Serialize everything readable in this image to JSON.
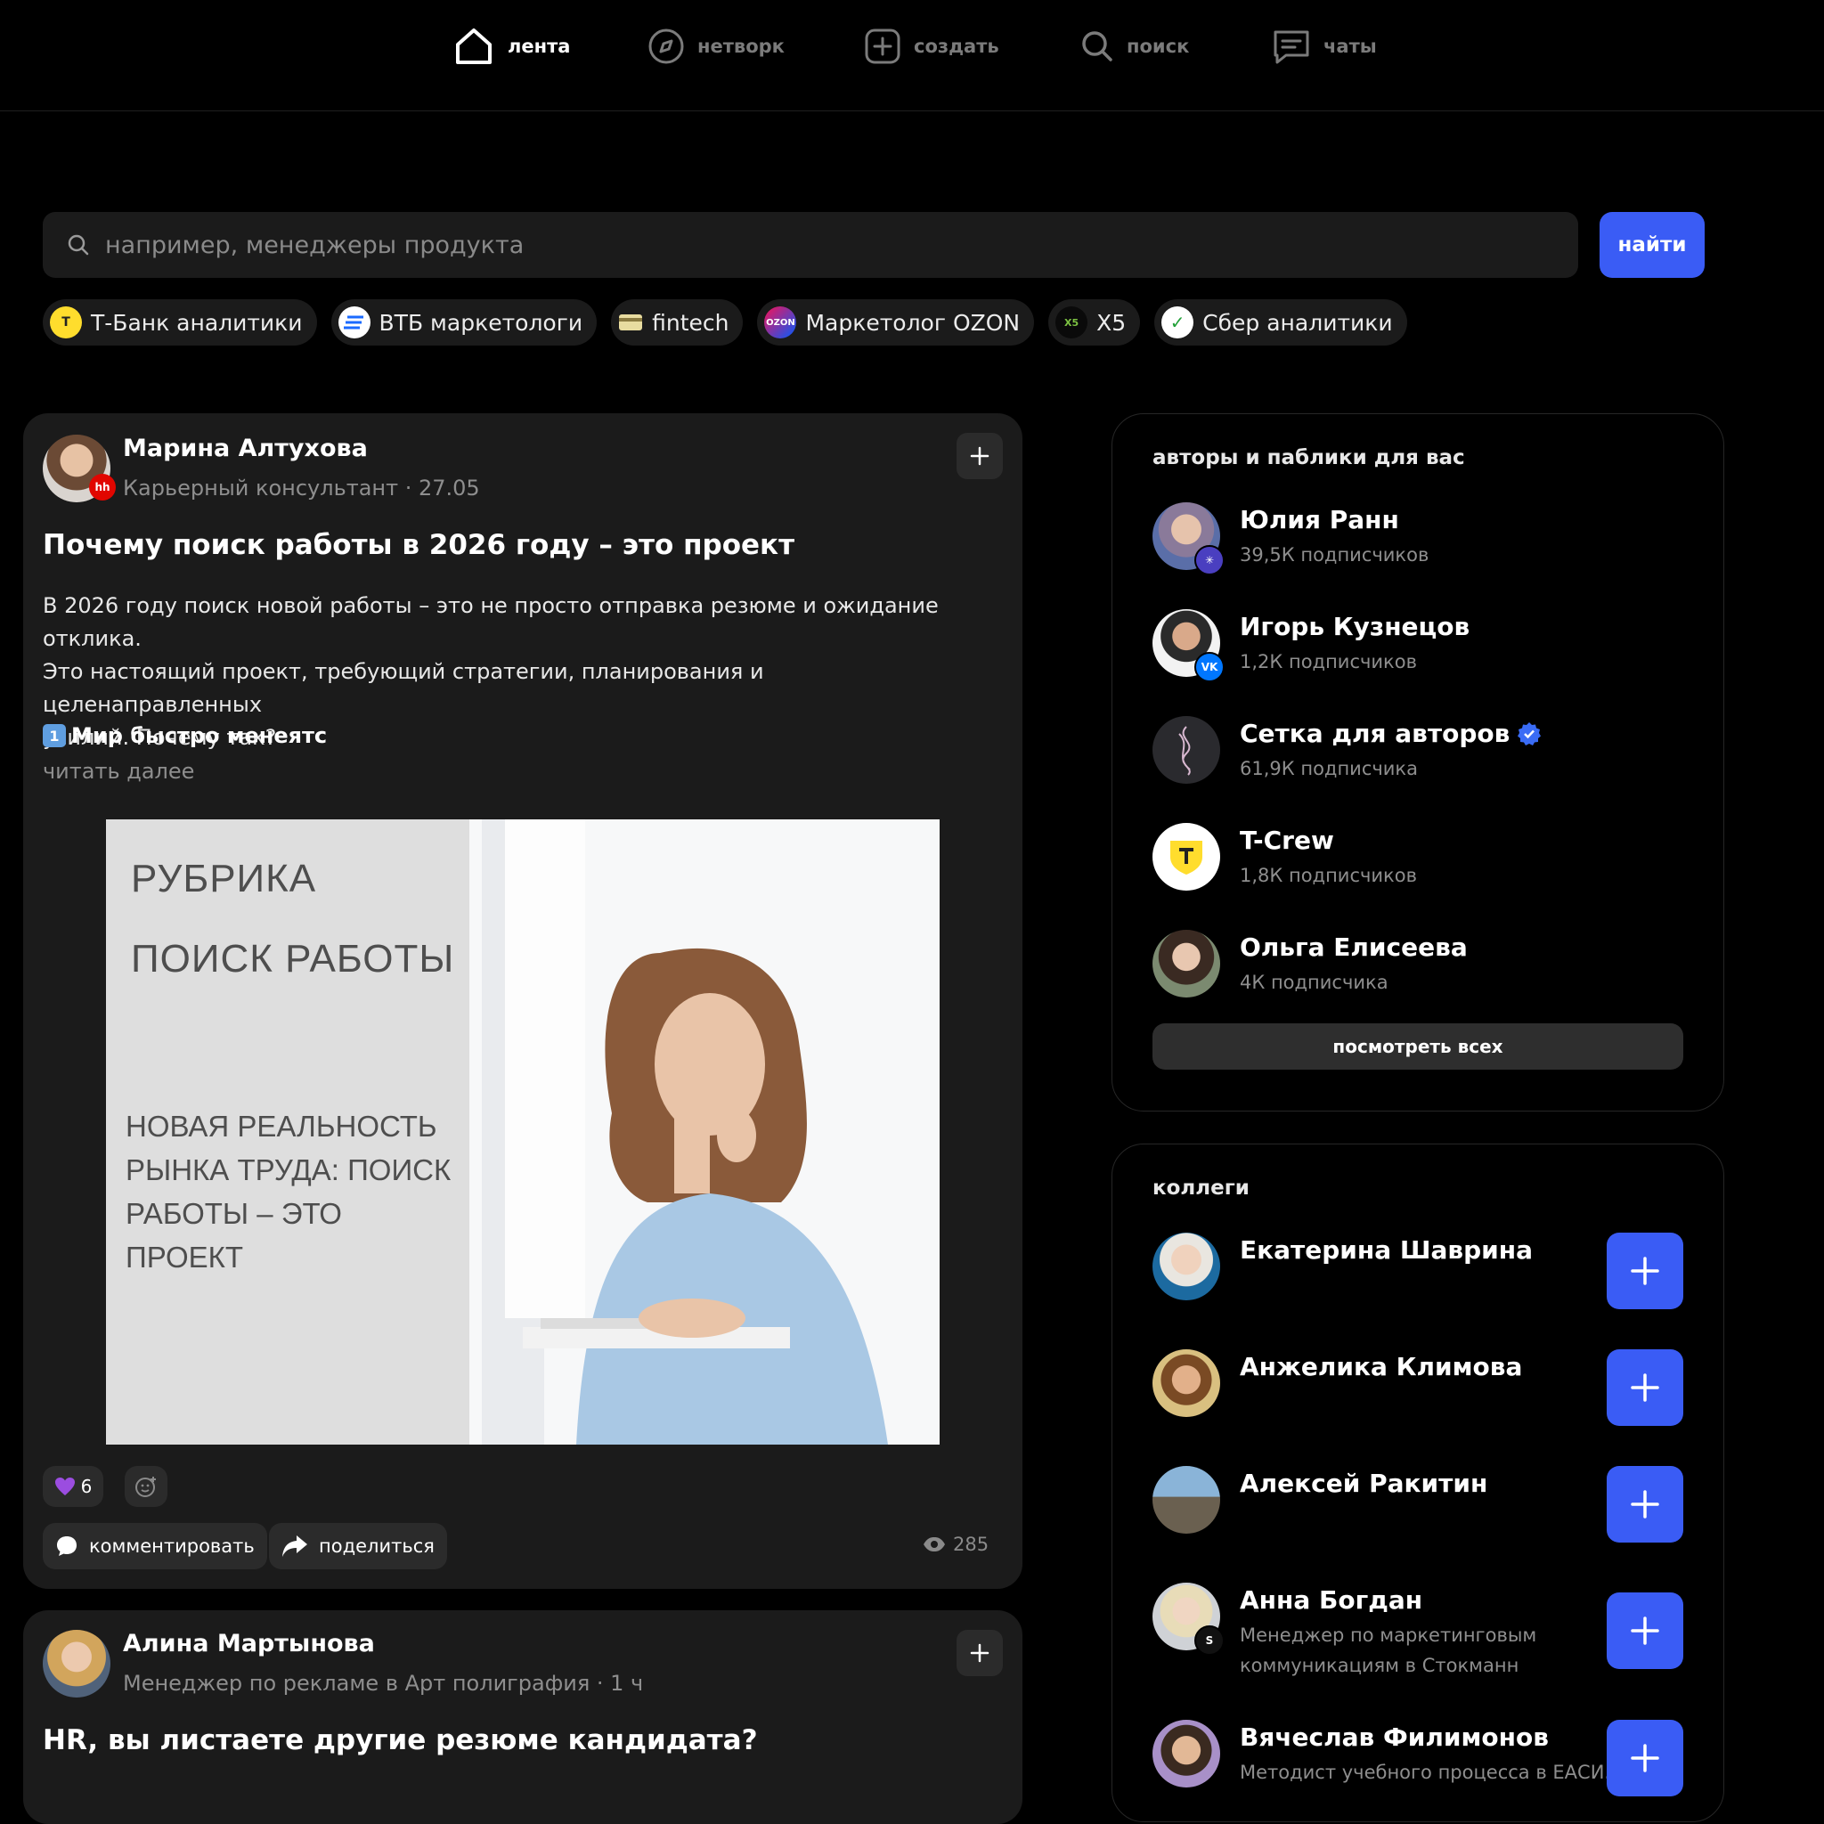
{
  "nav": {
    "feed": "лента",
    "network": "нетворк",
    "create": "создать",
    "search": "поиск",
    "chats": "чаты"
  },
  "search": {
    "placeholder": "например, менеджеры продукта",
    "button": "найти"
  },
  "chips": [
    {
      "label": "Т-Банк аналитики",
      "logo": "Т",
      "color": "#ffdd2d"
    },
    {
      "label": "ВТБ маркетологи",
      "logo": "≡",
      "color": "#1a6aff"
    },
    {
      "label": "fintech",
      "logo": "card",
      "color": "#e8dca0"
    },
    {
      "label": "Маркетолог OZON",
      "logo": "OZON",
      "color": "#f91155"
    },
    {
      "label": "X5",
      "logo": "X5",
      "color": "#1a1a1a"
    },
    {
      "label": "Сбер аналитики",
      "logo": "✓",
      "color": "#21a038"
    }
  ],
  "post1": {
    "author": "Марина Алтухова",
    "meta": "Карьерный консультант · 27.05",
    "badge": "hh",
    "title": "Почему поиск работы в 2026 году – это проект",
    "body_lines": [
      "В 2026 году поиск новой работы – это не просто отправка резюме и ожидание отклика.",
      "Это настоящий проект, требующий стратегии, планирования и целенаправленных",
      "усилий. Почему так?"
    ],
    "subheading_num": "1",
    "subheading": "Мир быстро менеятс",
    "read_more": "читать далее",
    "image": {
      "line1": "РУБРИКА",
      "line2": "ПОИСК РАБОТЫ",
      "lines3": [
        "НОВАЯ РЕАЛЬНОСТЬ",
        "РЫНКА ТРУДА: ПОИСК",
        "РАБОТЫ – ЭТО",
        "ПРОЕКТ"
      ]
    },
    "likes": "6",
    "comment": "комментировать",
    "share": "поделиться",
    "views": "285"
  },
  "post2": {
    "author": "Алина Мартынова",
    "meta": "Менеджер по рекламе в Арт полиграфия · 1 ч",
    "title": "HR, вы листаете другие резюме кандидата?"
  },
  "authors": {
    "title": "авторы и паблики для вас",
    "items": [
      {
        "name": "Юлия Ранн",
        "sub": "39,5К подписчиков"
      },
      {
        "name": "Игорь Кузнецов",
        "sub": "1,2К подписчиков"
      },
      {
        "name": "Сетка для авторов",
        "sub": "61,9К подписчика"
      },
      {
        "name": "T-Crew",
        "sub": "1,8К подписчиков"
      },
      {
        "name": "Ольга Елисеева",
        "sub": "4К подписчика"
      }
    ],
    "see_all": "посмотреть всех"
  },
  "colleagues": {
    "title": "коллеги",
    "items": [
      {
        "name": "Екатерина Шаврина",
        "sub": ""
      },
      {
        "name": "Анжелика Климова",
        "sub": ""
      },
      {
        "name": "Алексей Ракитин",
        "sub": ""
      },
      {
        "name": "Анна Богдан",
        "sub": "Менеджер по маркетинговым",
        "sub2": "коммуникациям в Стокманн"
      },
      {
        "name": "Вячеслав Филимонов",
        "sub": "Методист учебного процесса в ЕАСИ."
      }
    ]
  },
  "colors": {
    "accent": "#3a5cf5",
    "card": "#1b1b1b",
    "verified": "#3a6cf5"
  }
}
